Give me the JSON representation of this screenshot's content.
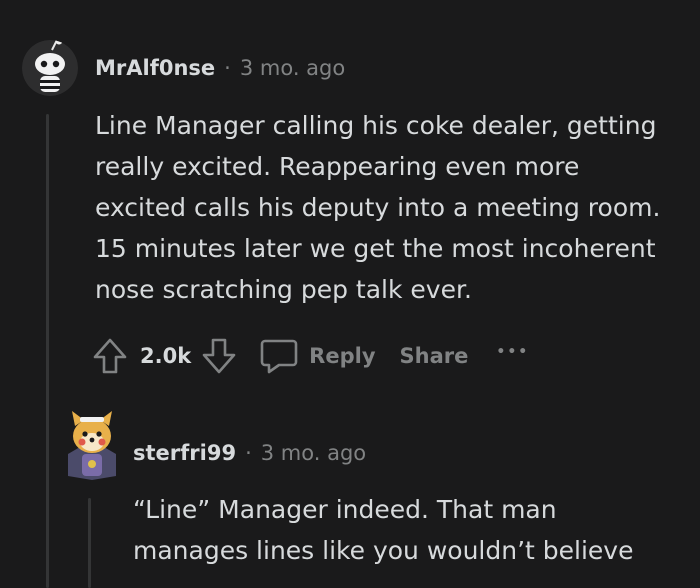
{
  "comments": [
    {
      "username": "MrAlf0nse",
      "separator": "·",
      "timestamp": "3 mo. ago",
      "body": "Line Manager calling his coke dealer, getting really excited. Reappearing even more excited calls his deputy into a meeting room. 15 minutes later we get the most incoherent nose scratching pep talk ever.",
      "score": "2.0k",
      "reply_label": "Reply",
      "share_label": "Share",
      "more_label": "•••"
    },
    {
      "username": "sterfri99",
      "separator": "·",
      "timestamp": "3 mo. ago",
      "body": "“Line” Manager indeed. That man manages lines like you wouldn’t believe"
    }
  ],
  "colors": {
    "background": "#1a1a1b",
    "text": "#d7dadc",
    "muted": "#818384",
    "thread_line": "#343536"
  },
  "icons": [
    "alien-avatar-icon",
    "shiba-avatar-icon",
    "upvote-icon",
    "downvote-icon",
    "comment-icon"
  ]
}
